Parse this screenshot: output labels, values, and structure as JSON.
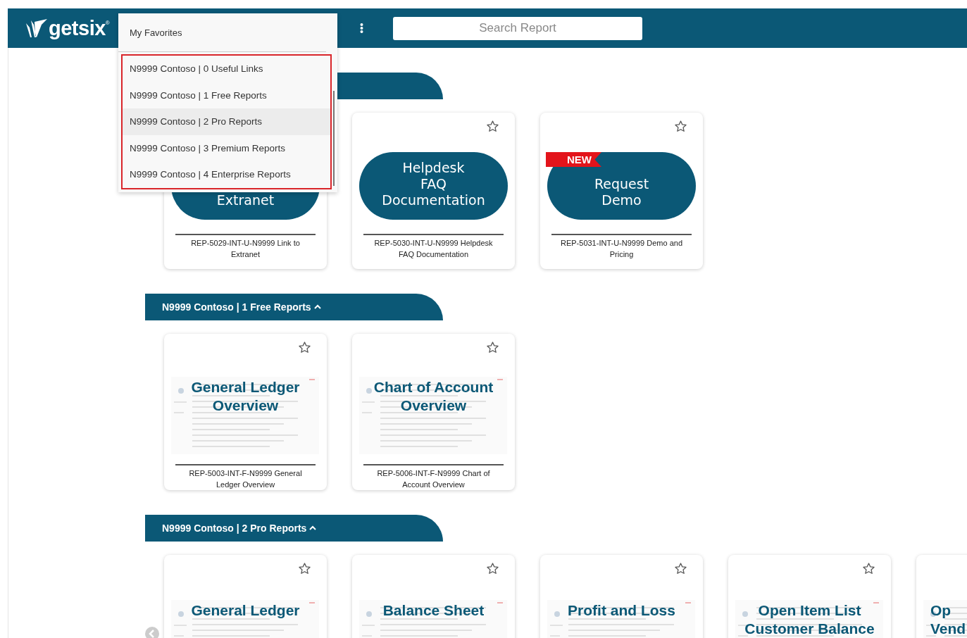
{
  "header": {
    "logo": "getsix",
    "logo_mark": "®",
    "favorites": {
      "label": "My Favorites",
      "options": [
        {
          "label": "N9999 Contoso | 0 Useful Links",
          "selected": false
        },
        {
          "label": "N9999 Contoso | 1 Free Reports",
          "selected": false
        },
        {
          "label": "N9999 Contoso | 2 Pro Reports",
          "selected": true
        },
        {
          "label": "N9999 Contoso | 3 Premium Reports",
          "selected": false
        },
        {
          "label": "N9999 Contoso | 4 Enterprise Reports",
          "selected": false
        }
      ]
    },
    "search": {
      "placeholder": "Search Report"
    }
  },
  "sections": [
    {
      "cards": [
        {
          "kind": "pill",
          "lines": [
            "Extranet"
          ],
          "caption": "REP-5029-INT-U-N9999 Link to Extranet"
        },
        {
          "kind": "pill",
          "lines": [
            "Helpdesk",
            "FAQ",
            "Documentation"
          ],
          "favorite": false,
          "caption": "REP-5030-INT-U-N9999 Helpdesk FAQ Documentation"
        },
        {
          "kind": "pill",
          "badge": "NEW",
          "lines": [
            "Request",
            "Demo"
          ],
          "favorite": false,
          "caption": "REP-5031-INT-U-N9999 Demo and Pricing"
        }
      ]
    },
    {
      "title": "N9999 Contoso | 1 Free Reports",
      "expanded": true,
      "cards": [
        {
          "kind": "screenshot",
          "lines": [
            "General Ledger",
            "Overview"
          ],
          "favorite": false,
          "caption": "REP-5003-INT-F-N9999 General Ledger Overview"
        },
        {
          "kind": "screenshot",
          "lines": [
            "Chart of Account",
            "Overview"
          ],
          "favorite": false,
          "caption": "REP-5006-INT-F-N9999 Chart of Account Overview"
        }
      ]
    },
    {
      "title": "N9999 Contoso | 2 Pro Reports",
      "expanded": true,
      "cards": [
        {
          "kind": "screenshot",
          "lines": [
            "General Ledger"
          ],
          "favorite": false
        },
        {
          "kind": "screenshot",
          "lines": [
            "Balance Sheet"
          ],
          "favorite": false
        },
        {
          "kind": "screenshot",
          "lines": [
            "Profit and Loss"
          ],
          "favorite": false
        },
        {
          "kind": "screenshot",
          "lines": [
            "Open Item List",
            "Customer Balance"
          ],
          "favorite": false
        },
        {
          "kind": "screenshot",
          "lines": [
            "Op",
            "Vend"
          ],
          "clipped": true
        }
      ]
    }
  ]
}
